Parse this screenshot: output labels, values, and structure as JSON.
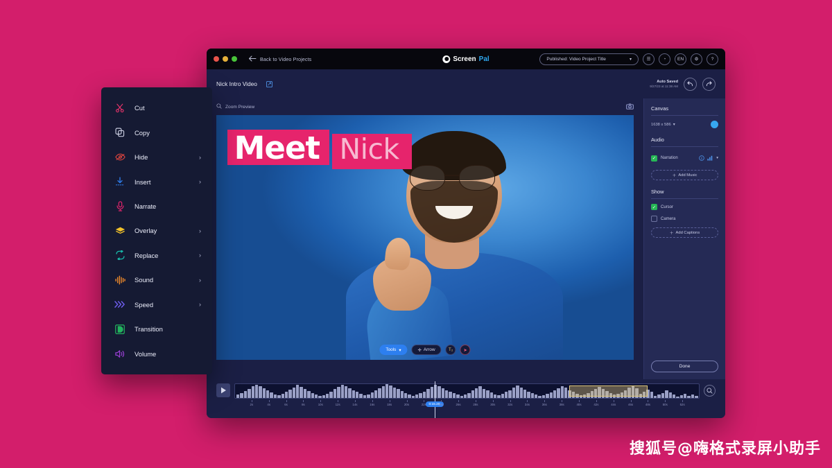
{
  "window": {
    "titlebar": {
      "back_label": "Back to Video Projects",
      "brand_first": "Screen",
      "brand_second": "Pal",
      "published_label": "Published: Video Project Title",
      "buttons": [
        {
          "name": "export-icon",
          "glyph": "☰"
        },
        {
          "name": "history-icon",
          "glyph": "◴"
        },
        {
          "name": "language-button",
          "glyph": "EN"
        },
        {
          "name": "settings-gear-icon",
          "glyph": "⚙"
        },
        {
          "name": "help-icon",
          "glyph": "?"
        }
      ]
    },
    "projectbar": {
      "title": "Nick Intro Video",
      "autosave_label": "Auto Saved",
      "autosave_time": "9/27/23 at 11:38 AM",
      "undo_glyph": "↶",
      "redo_glyph": "↷"
    }
  },
  "stage": {
    "zoom_preview_label": "Zoom Preview",
    "title_line1": "Meet",
    "title_line2": "Nick",
    "toolbar": {
      "tools_label": "Tools",
      "arrow_label": "Arrow",
      "text_tool_glyph": "T₂",
      "cursor_tool_glyph": "➤"
    }
  },
  "panel": {
    "canvas": {
      "heading": "Canvas",
      "size_value": "1638 x 586",
      "color": "#37a7f0"
    },
    "audio": {
      "heading": "Audio",
      "narration_label": "Narration",
      "narration_checked": true,
      "add_music_label": "Add Music"
    },
    "show": {
      "heading": "Show",
      "cursor_label": "Cursor",
      "cursor_checked": true,
      "camera_label": "Camera",
      "camera_checked": false,
      "add_captions_label": "Add Captions"
    },
    "done_label": "Done"
  },
  "timeline": {
    "play_glyph": "▶",
    "current_time": "0:15.20",
    "playhead_percent": 43,
    "ticks": [
      "2s",
      "4s",
      "6s",
      "8s",
      "10s",
      "12s",
      "14s",
      "16s",
      "18s",
      "20s",
      "22s",
      "24s",
      "26s",
      "28s",
      "30s",
      "32s",
      "34s",
      "36s",
      "38s",
      "40s",
      "42s",
      "44s",
      "46s",
      "48s",
      "50s",
      "52s"
    ],
    "waveform": [
      4,
      7,
      5,
      9,
      6,
      3,
      8,
      12,
      16,
      10,
      7,
      5,
      14,
      18,
      13,
      9,
      21,
      26,
      22,
      17,
      12,
      9,
      7,
      11,
      15,
      19,
      24,
      20,
      15,
      11,
      8,
      6,
      9,
      13,
      17,
      22,
      26,
      21,
      16,
      12,
      9,
      6,
      4,
      7,
      10,
      14,
      18,
      23,
      27,
      22,
      17,
      13,
      9,
      6,
      8,
      12,
      16,
      20,
      25,
      21,
      16,
      11,
      8,
      5,
      7,
      10,
      13,
      17,
      21,
      25,
      28,
      24,
      19,
      14,
      10,
      7,
      5,
      8,
      11,
      15,
      19,
      23,
      27,
      30,
      26,
      21,
      16,
      12,
      8,
      6,
      9,
      13,
      17,
      21,
      25,
      29,
      24,
      19,
      14,
      9,
      6,
      4,
      7,
      11,
      15,
      20,
      24,
      28,
      23,
      18,
      13,
      9,
      6,
      8,
      12,
      16,
      21,
      25,
      29,
      26,
      20,
      15,
      10,
      7
    ]
  },
  "context_menu": {
    "items": [
      {
        "label": "Cut",
        "icon": "scissors-icon",
        "color": "#e8336b",
        "glyph": "✂",
        "submenu": false
      },
      {
        "label": "Copy",
        "icon": "copy-icon",
        "color": "#d9dcef",
        "glyph": "⧉",
        "submenu": false
      },
      {
        "label": "Hide",
        "icon": "eye-hidden-icon",
        "color": "#e0453f",
        "glyph": "⌽",
        "submenu": true
      },
      {
        "label": "Insert",
        "icon": "insert-icon",
        "color": "#2f7ff0",
        "glyph": "↓",
        "submenu": true
      },
      {
        "label": "Narrate",
        "icon": "microphone-icon",
        "color": "#e0246b",
        "glyph": "Ἲ4",
        "submenu": false
      },
      {
        "label": "Overlay",
        "icon": "layers-icon",
        "color": "#f0c02a",
        "glyph": "◆",
        "submenu": true
      },
      {
        "label": "Replace",
        "icon": "swap-icon",
        "color": "#18bfae",
        "glyph": "↻",
        "submenu": true
      },
      {
        "label": "Sound",
        "icon": "waveform-icon",
        "color": "#ef8a2a",
        "glyph": "‖",
        "submenu": true
      },
      {
        "label": "Speed",
        "icon": "chevrons-icon",
        "color": "#6f5ef0",
        "glyph": "»",
        "submenu": true
      },
      {
        "label": "Transition",
        "icon": "transition-icon",
        "color": "#22b35e",
        "glyph": "◗",
        "submenu": false
      },
      {
        "label": "Volume",
        "icon": "speaker-icon",
        "color": "#9b3fd6",
        "glyph": "ὐ8",
        "submenu": false
      }
    ]
  },
  "watermark": {
    "text": "搜狐号@嗨格式录屏小助手"
  }
}
